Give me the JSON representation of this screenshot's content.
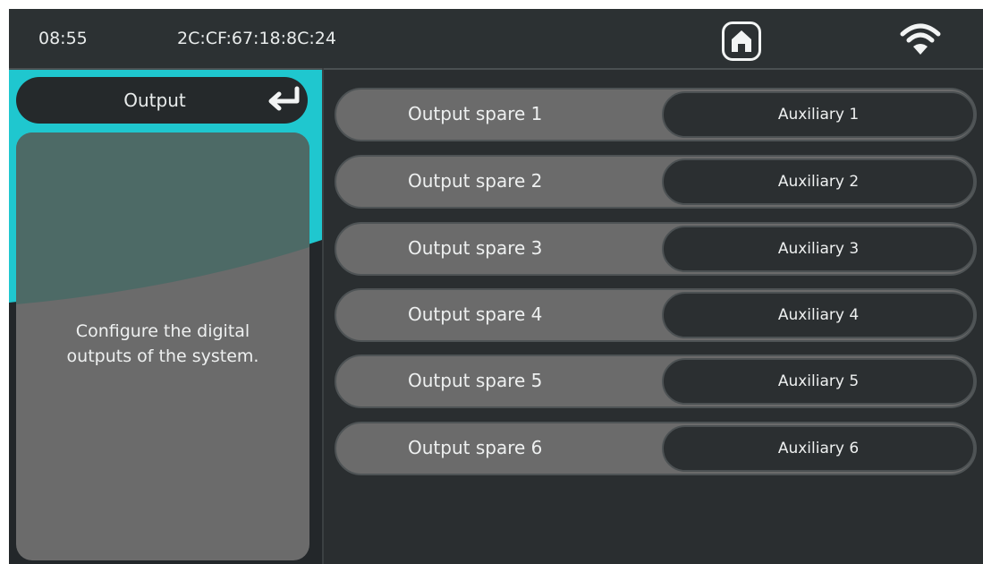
{
  "status_bar": {
    "time": "08:55",
    "mac_address": "2C:CF:67:18:8C:24",
    "home_icon": "home-icon",
    "wifi_icon": "wifi-icon"
  },
  "left_panel": {
    "title": "Output",
    "back_icon": "return-arrow-icon",
    "description": "Configure the digital\noutputs of the system."
  },
  "outputs": [
    {
      "label": "Output spare 1",
      "value": "Auxiliary 1"
    },
    {
      "label": "Output spare 2",
      "value": "Auxiliary 2"
    },
    {
      "label": "Output spare 3",
      "value": "Auxiliary 3"
    },
    {
      "label": "Output spare 4",
      "value": "Auxiliary 4"
    },
    {
      "label": "Output spare 5",
      "value": "Auxiliary 5"
    },
    {
      "label": "Output spare 6",
      "value": "Auxiliary 6"
    }
  ],
  "colors": {
    "accent": "#1fc7cf",
    "background": "#2a2e30",
    "card": "#6b6b6b",
    "pill": "#2b2f31"
  }
}
